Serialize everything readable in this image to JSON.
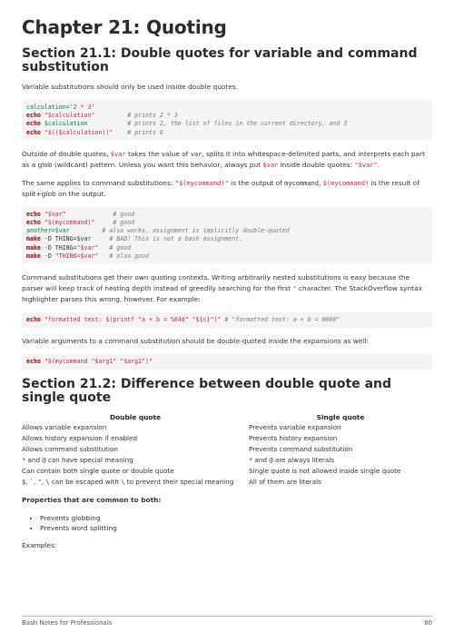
{
  "chapter_title": "Chapter 21: Quoting",
  "section1": {
    "title": "Section 21.1: Double quotes for variable and command substitution",
    "intro": "Variable substitutions should only be used inside double quotes.",
    "code1": [
      [
        [
          "var",
          "calculation="
        ],
        [
          "str",
          "'2 * 3'"
        ]
      ],
      [
        [
          "kw",
          "echo"
        ],
        [
          "pl",
          " "
        ],
        [
          "str",
          "\"$calculation\""
        ],
        [
          "pl",
          "         "
        ],
        [
          "cm",
          "# prints 2 * 3"
        ]
      ],
      [
        [
          "kw",
          "echo"
        ],
        [
          "pl",
          " "
        ],
        [
          "var",
          "$calculation"
        ],
        [
          "pl",
          "           "
        ],
        [
          "cm",
          "# prints 2, the list of files in the current directory, and 3"
        ]
      ],
      [
        [
          "kw",
          "echo"
        ],
        [
          "pl",
          " "
        ],
        [
          "str",
          "\"$(($calculation))\""
        ],
        [
          "pl",
          "    "
        ],
        [
          "cm",
          "# prints 6"
        ]
      ]
    ],
    "para2": [
      [
        "t",
        "Outside of double quotes, "
      ],
      [
        "ic",
        "$var"
      ],
      [
        "t",
        " takes the value of "
      ],
      [
        "icd",
        "var"
      ],
      [
        "t",
        ", splits it into whitespace-delimited parts, and interprets each part as a glob (wildcard) pattern. Unless you want this behavior, always put "
      ],
      [
        "ic",
        "$var"
      ],
      [
        "t",
        " inside double quotes: "
      ],
      [
        "ic",
        "\"$var\""
      ],
      [
        "t",
        "."
      ]
    ],
    "para3": [
      [
        "t",
        "The same applies to command substitutions: "
      ],
      [
        "ic",
        "\"$(mycommand)\""
      ],
      [
        "t",
        " is the output of "
      ],
      [
        "icd",
        "mycommand"
      ],
      [
        "t",
        ", "
      ],
      [
        "ic",
        "$(mycommand)"
      ],
      [
        "t",
        " is the result of split+glob on the output."
      ]
    ],
    "code2": [
      [
        [
          "kw",
          "echo"
        ],
        [
          "pl",
          " "
        ],
        [
          "str",
          "\"$var\""
        ],
        [
          "pl",
          "             "
        ],
        [
          "cm",
          "# good"
        ]
      ],
      [
        [
          "kw",
          "echo"
        ],
        [
          "pl",
          " "
        ],
        [
          "str",
          "\"$(mycommand)\""
        ],
        [
          "pl",
          "     "
        ],
        [
          "cm",
          "# good"
        ]
      ],
      [
        [
          "var",
          "another=$var"
        ],
        [
          "pl",
          "         "
        ],
        [
          "cm",
          "# also works, assignment is implicitly double-quoted"
        ]
      ],
      [
        [
          "kw",
          "make"
        ],
        [
          "pl",
          " -D THING=$var     "
        ],
        [
          "cm",
          "# BAD! This is not a bash assignment."
        ]
      ],
      [
        [
          "kw",
          "make"
        ],
        [
          "pl",
          " -D THING="
        ],
        [
          "str",
          "\"$var\""
        ],
        [
          "pl",
          "   "
        ],
        [
          "cm",
          "# good"
        ]
      ],
      [
        [
          "kw",
          "make"
        ],
        [
          "pl",
          " -D "
        ],
        [
          "str",
          "\"THING=$var\""
        ],
        [
          "pl",
          "   "
        ],
        [
          "cm",
          "# also good"
        ]
      ]
    ],
    "para4": [
      [
        "t",
        "Command substitutions get their own quoting contexts. Writing arbitrarily nested substitutions is easy because the parser will keep track of nesting depth instead of greedily searching for the first "
      ],
      [
        "ic",
        "\""
      ],
      [
        "t",
        " character. The StackOverflow syntax highlighter parses this wrong, however. For example:"
      ]
    ],
    "code3": [
      [
        [
          "kw",
          "echo"
        ],
        [
          "pl",
          " "
        ],
        [
          "str",
          "\"formatted text: $(printf \"a + b = %04d\" \"${c}\")\""
        ],
        [
          "pl",
          " "
        ],
        [
          "cm",
          "# \"formatted text: a + b = 0000\""
        ]
      ]
    ],
    "para5": "Variable arguments to a command substitution should be double-quoted inside the expansions as well:",
    "code4": [
      [
        [
          "kw",
          "echo"
        ],
        [
          "pl",
          " "
        ],
        [
          "str",
          "\"$(mycommand \"$arg1\" \"$arg2\")\""
        ]
      ]
    ]
  },
  "section2": {
    "title": "Section 21.2: Difference between double quote and single quote",
    "table_headers": [
      "Double quote",
      "Single quote"
    ],
    "table_rows": [
      [
        [
          [
            "t",
            "Allows variable expansion"
          ]
        ],
        [
          [
            "t",
            "Prevents variable expansion"
          ]
        ]
      ],
      [
        [
          [
            "t",
            "Allows history expansion if enabled"
          ]
        ],
        [
          [
            "t",
            "Prevents history expansion"
          ]
        ]
      ],
      [
        [
          [
            "t",
            "Allows command substitution"
          ]
        ],
        [
          [
            "t",
            "Prevents command substitution"
          ]
        ]
      ],
      [
        [
          [
            "icd",
            "*"
          ],
          [
            "t",
            " and "
          ],
          [
            "icd",
            "@"
          ],
          [
            "t",
            " can have special meaning"
          ]
        ],
        [
          [
            "icd",
            "*"
          ],
          [
            "t",
            " and "
          ],
          [
            "icd",
            "@"
          ],
          [
            "t",
            " are always literals"
          ]
        ]
      ],
      [
        [
          [
            "t",
            "Can contain both single quote or double quote"
          ]
        ],
        [
          [
            "t",
            "Single quote is not allowed inside single quote"
          ]
        ]
      ],
      [
        [
          [
            "icd",
            "$"
          ],
          [
            "t",
            ", "
          ],
          [
            "icd",
            "`"
          ],
          [
            "t",
            ", "
          ],
          [
            "icd",
            "\""
          ],
          [
            "t",
            ", "
          ],
          [
            "icd",
            "\\"
          ],
          [
            "t",
            " can be escaped with "
          ],
          [
            "icd",
            "\\"
          ],
          [
            "t",
            " to prevent their special meaning"
          ]
        ],
        [
          [
            "t",
            "All of them are literals"
          ]
        ]
      ]
    ],
    "common_heading": "Properties that are common to both:",
    "common_items": [
      "Prevents globbing",
      "Prevents word splitting"
    ],
    "examples_label": "Examples:"
  },
  "footer": {
    "book": "Bash Notes for Professionals",
    "page": "80"
  }
}
